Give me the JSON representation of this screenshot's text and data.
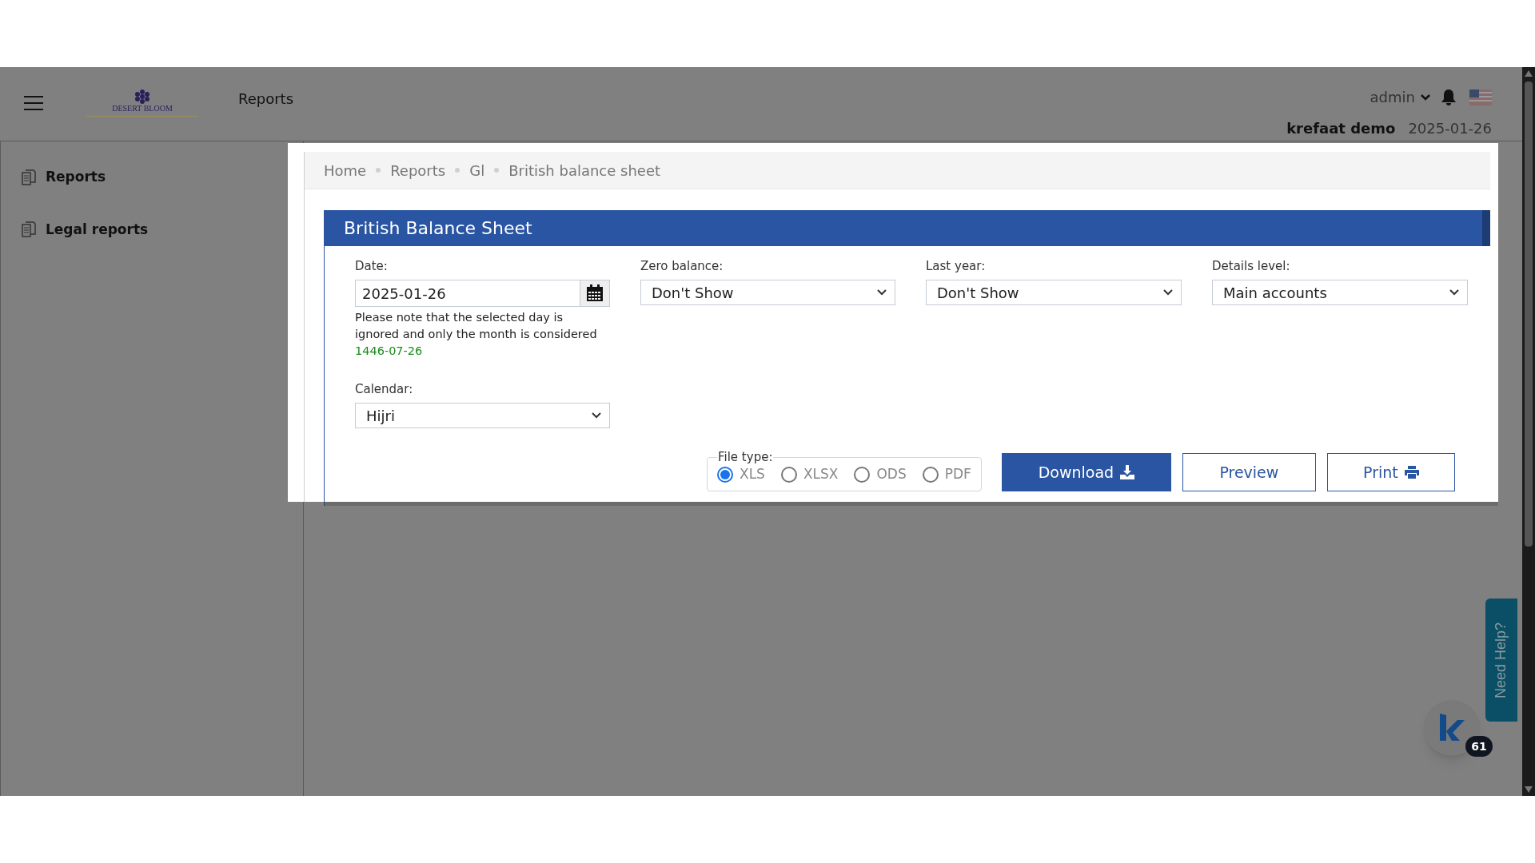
{
  "header": {
    "logo_text": "DESERT BLOOM",
    "page_title": "Reports",
    "user": "admin",
    "company": "krefaat demo",
    "date": "2025-01-26"
  },
  "sidebar": {
    "items": [
      {
        "label": "Reports"
      },
      {
        "label": "Legal reports"
      }
    ]
  },
  "breadcrumb": [
    "Home",
    "Reports",
    "Gl",
    "British balance sheet"
  ],
  "form": {
    "title": "British Balance Sheet",
    "date": {
      "label": "Date:",
      "value": "2025-01-26",
      "note": "Please note that the selected day is ignored and only the month is considered",
      "converted": "1446-07-26"
    },
    "selects": [
      {
        "label": "Zero balance:",
        "value": "Don't Show"
      },
      {
        "label": "Last year:",
        "value": "Don't Show"
      },
      {
        "label": "Details level:",
        "value": "Main accounts"
      }
    ],
    "calendar": {
      "label": "Calendar:",
      "value": "Hijri"
    },
    "file_type": {
      "label": "File type:",
      "options": [
        {
          "label": "XLS",
          "selected": true
        },
        {
          "label": "XLSX",
          "selected": false
        },
        {
          "label": "ODS",
          "selected": false
        },
        {
          "label": "PDF",
          "selected": false
        }
      ]
    },
    "buttons": [
      {
        "label": "Download",
        "kind": "download"
      },
      {
        "label": "Preview",
        "kind": "preview"
      },
      {
        "label": "Print",
        "kind": "print"
      }
    ]
  },
  "help_tab": "Need Help?",
  "chat_badge": "61"
}
